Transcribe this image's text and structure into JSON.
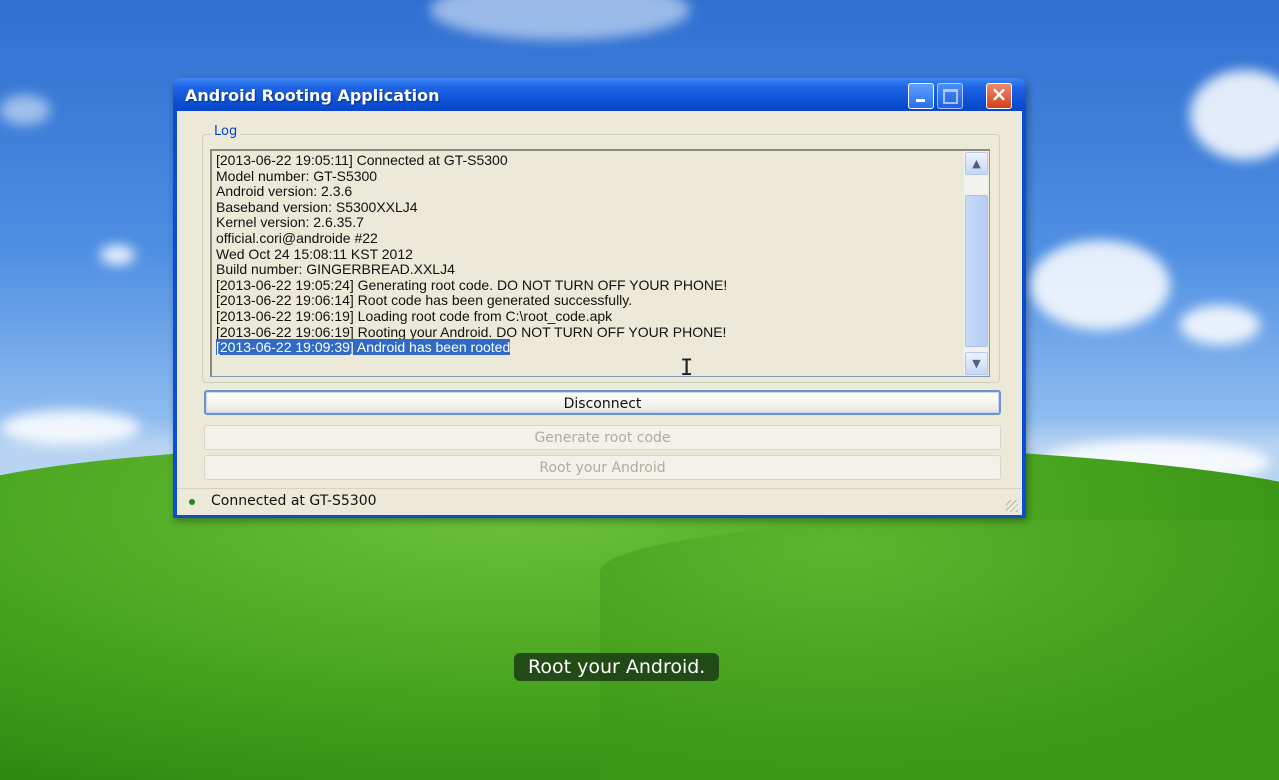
{
  "window": {
    "title": "Android Rooting Application",
    "controls": {
      "minimize": "minimize-icon",
      "maximize": "maximize-icon",
      "close": "×"
    }
  },
  "log": {
    "label": "Log",
    "lines": [
      "[2013-06-22 19:05:11] Connected at GT-S5300",
      "Model number: GT-S5300",
      "Android version: 2.3.6",
      "Baseband version: S5300XXLJ4",
      "Kernel version: 2.6.35.7",
      "official.cori@androide #22",
      "Wed Oct 24 15:08:11 KST 2012",
      "Build number: GINGERBREAD.XXLJ4",
      "[2013-06-22 19:05:24] Generating root code. DO NOT TURN OFF YOUR PHONE!",
      "[2013-06-22 19:06:14] Root code has been generated successfully.",
      "[2013-06-22 19:06:19] Loading root code from C:\\root_code.apk",
      "[2013-06-22 19:06:19] Rooting your Android. DO NOT TURN OFF YOUR PHONE!",
      "[2013-06-22 19:09:39] Android has been rooted"
    ],
    "selected_index": 12
  },
  "buttons": {
    "disconnect": "Disconnect",
    "generate": "Generate root code",
    "root": "Root your Android"
  },
  "status": {
    "text": "Connected at GT-S5300",
    "indicator_color": "#1f8a1f"
  },
  "subtitle": "Root your Android."
}
